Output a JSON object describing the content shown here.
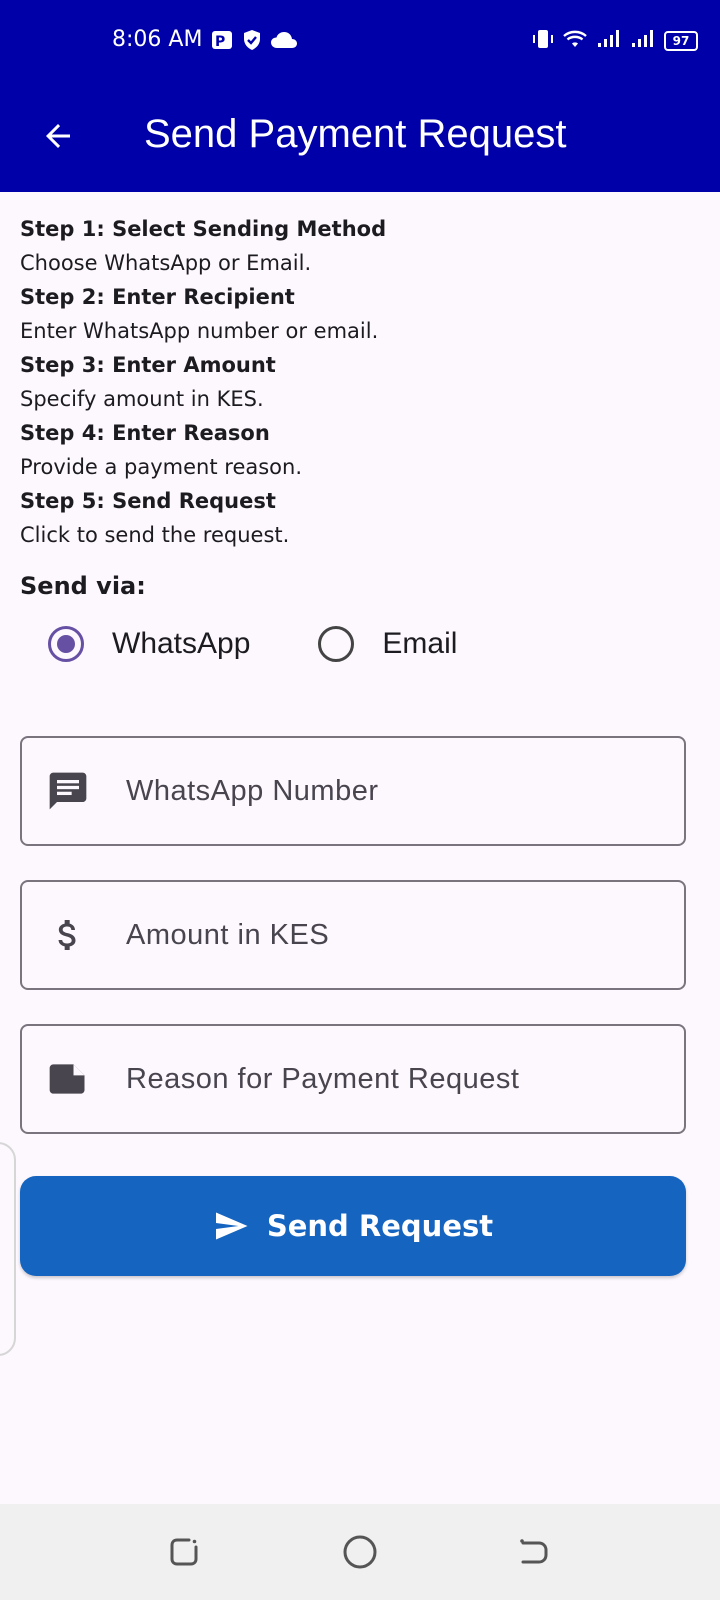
{
  "status_bar": {
    "time": "8:06 AM",
    "battery": "97"
  },
  "app_bar": {
    "title": "Send Payment Request"
  },
  "steps": [
    {
      "title": "Step 1: Select Sending Method",
      "desc": "Choose WhatsApp or Email."
    },
    {
      "title": "Step 2: Enter Recipient",
      "desc": "Enter WhatsApp number or email."
    },
    {
      "title": "Step 3: Enter Amount",
      "desc": "Specify amount in KES."
    },
    {
      "title": "Step 4: Enter Reason",
      "desc": "Provide a payment reason."
    },
    {
      "title": "Step 5: Send Request",
      "desc": "Click to send the request."
    }
  ],
  "send_via": {
    "label": "Send via:",
    "options": [
      {
        "label": "WhatsApp",
        "selected": true
      },
      {
        "label": "Email",
        "selected": false
      }
    ]
  },
  "fields": {
    "recipient": {
      "placeholder": "WhatsApp Number",
      "value": "",
      "icon": "message-icon"
    },
    "amount": {
      "placeholder": "Amount in KES",
      "value": "",
      "icon": "dollar-icon"
    },
    "reason": {
      "placeholder": "Reason for Payment Request",
      "value": "",
      "icon": "note-icon"
    }
  },
  "send_button": {
    "label": "Send Request",
    "icon": "send-icon"
  },
  "colors": {
    "app_bar": "#0000a8",
    "accent": "#6650a4",
    "button": "#1565c0",
    "background": "#fdf7fe"
  }
}
